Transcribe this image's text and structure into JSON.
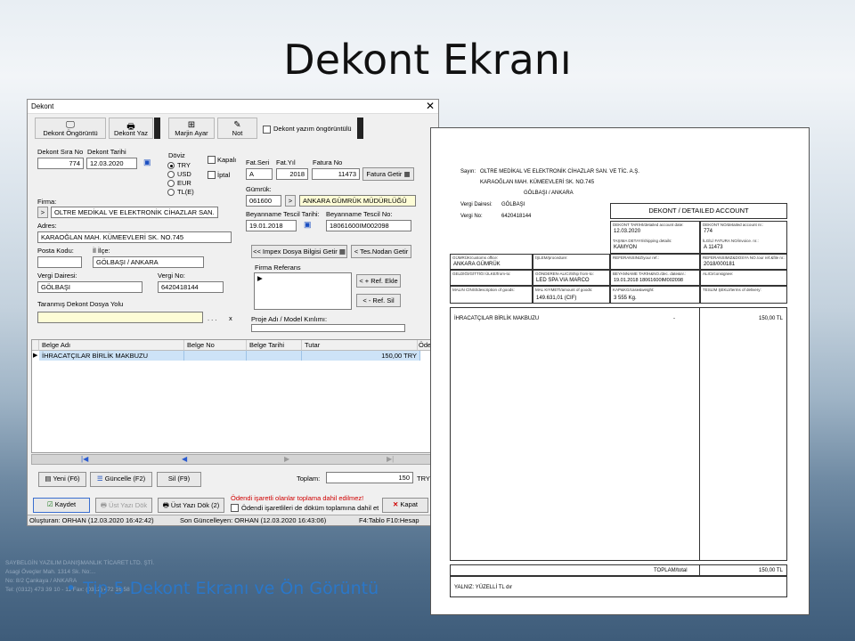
{
  "slide": {
    "title": "Dekont Ekranı",
    "bullet": "Tip 5 Dekont Ekranı ve Ön Görüntü",
    "bg_caption": [
      "SAYBELGİN YAZILIM DANIŞMANLIK TİCARET LTD. ŞTİ.",
      "Asagi Öveçler Mah. 1314 Sk. No:...",
      "No: 8/2 Çankaya / ANKARA",
      "Tel: (0312) 473 39 10 - 11 Fax: (0312) 472 16 58"
    ]
  },
  "dialog": {
    "title": "Dekont",
    "toolbar": {
      "preview": "Dekont Öngörüntü",
      "print": "Dekont Yaz",
      "margin": "Marjin Ayar",
      "note": "Not",
      "print_preview_check": "Dekont yazım öngörüntülü"
    },
    "fields": {
      "sira_no_label": "Dekont Sıra No",
      "sira_no": "774",
      "tarih_label": "Dekont Tarihi",
      "tarih": "12.03.2020",
      "doviz_label": "Döviz",
      "doviz_options": [
        "TRY",
        "USD",
        "EUR",
        "TL(E)"
      ],
      "doviz_selected": "TRY",
      "kapali": "Kapalı",
      "iptal": "İptal",
      "firma_label": "Firma:",
      "firma": "OLTRE MEDİKAL VE ELEKTRONİK CİHAZLAR SAN.",
      "adres_label": "Adres:",
      "adres": "KARAOĞLAN MAH. KÜMEEVLERİ SK. NO.745",
      "posta_label": "Posta Kodu:",
      "posta": "",
      "ilce_label": "İl İlçe:",
      "ilce": "GÖLBAŞI / ANKARA",
      "vd_label": "Vergi Dairesi:",
      "vd": "GÖLBAŞI",
      "vno_label": "Vergi No:",
      "vno": "6420418144",
      "taranmis_label": "Taranmış Dekont Dosya Yolu",
      "taranmis": "",
      "dots": ". . .",
      "x": "x",
      "fat_seri_label": "Fat.Seri",
      "fat_seri": "A",
      "fat_yil_label": "Fat.Yıl",
      "fat_yil": "2018",
      "fatura_no_label": "Fatura No",
      "fatura_no": "11473",
      "fatura_getir": "Fatura Getir",
      "gumruk_label": "Gümrük:",
      "gumruk_kod": "061600",
      "gumruk_ad": "ANKARA GÜMRÜK MÜDÜRLÜĞÜ",
      "bey_tarih_label": "Beyanname Tescil Tarihi:",
      "bey_tarih": "19.01.2018",
      "bey_no_label": "Beyanname Tescil No:",
      "bey_no": "18061600IM002098",
      "impex_btn": "<< Impex Dosya Bilgisi Getir",
      "tes_btn": "< Tes.Nodan Getir",
      "firma_ref_label": "Firma Referans",
      "ref_ekle": "< + Ref. Ekle",
      "ref_sil": "< - Ref. Sil",
      "proje_label": "Proje Adı / Model Kırılımı:"
    },
    "grid": {
      "headers": [
        "Belge Adı",
        "Belge No",
        "Belge Tarihi",
        "Tutar",
        "Ödendi"
      ],
      "rows": [
        {
          "ad": "İHRACATÇILAR BİRLİK MAKBUZU",
          "no": "",
          "tarih": "",
          "tutar": "150,00 TRY"
        }
      ]
    },
    "nav": [
      "|◀",
      "◀",
      "▶",
      "▶|"
    ],
    "actions": {
      "yeni": "Yeni (F6)",
      "guncelle": "Güncelle (F2)",
      "sil": "Sil (F9)",
      "toplam_label": "Toplam:",
      "toplam": "150",
      "toplam_cur": "TRY"
    },
    "bottom": {
      "kaydet": "Kaydet",
      "ust_yazi_dok": "Üst Yazı Dök",
      "ust_yazi_dok2": "Üst Yazı Dök (2)",
      "warn": "Ödendi işaretli olanlar toplama dahil edilmez!",
      "check": "Ödendi işaretlileri de döküm toplamına dahil et",
      "kapat": "Kapat"
    },
    "status": {
      "olusturan": "Oluşturan: ORHAN (12.03.2020 16:42:42)",
      "guncelleyen": "Son Güncelleyen: ORHAN (12.03.2020 16:43:06)",
      "keys": "F4:Tablo F10:Hesap"
    }
  },
  "preview": {
    "sayin_label": "Sayın:",
    "firma": "OLTRE MEDİKAL VE ELEKTRONİK CİHAZLAR SAN. VE TİC. A.Ş.",
    "adres": "KARAOĞLAN MAH. KÜMEEVLERİ SK. NO.745",
    "ilce": "GÖLBAŞI / ANKARA",
    "vd_label": "Vergi Dairesi:",
    "vd": "GÖLBAŞI",
    "vno_label": "Vergi No:",
    "vno": "6420418144",
    "header": "DEKONT / DETAILED ACCOUNT",
    "c1_label": "DEKONT TARİHİ/detailed account date:",
    "c1": "12.03.2020",
    "c2_label": "DEKONT NO/detailed account nr.:",
    "c2": "774",
    "c3_label": "TAŞIMA DETAYI/shipping details:",
    "c3": "KAMYON",
    "c4_label": "İLGİLİ FATURA NO/invoice. nr.:",
    "c4": "A 11473",
    "r1a_label": "GÜMRÜK/customs office:",
    "r1a": "ANKARA GÜMRÜK",
    "r1b_label": "İŞLEM/procedure:",
    "r1b": "",
    "r1c_label": "REFERANSINIZ/your ref.:",
    "r1c": "",
    "r1d_label": "REFERANSIMIZ&DOSYA NO./our ref.&file nr.:",
    "r1d": "2018/000181",
    "r2a_label": "GELDİĞİ/GİTTİĞİ ÜLKE/from-to:",
    "r2a": "",
    "r2b_label": "GÖNDEREN-ALICI/Ship from-to:",
    "r2b": "LED SPA VIA MARCO",
    "r2c_label": "BEYANNAME TARİH&NO./dec. date&nr.:",
    "r2c": "19.01.2018   18061600IM002098",
    "r2d_label": "ALICI/consignee:",
    "r2d": "",
    "r3a_label": "MALIN CİNSİ/description of goods:",
    "r3a": "",
    "r3b_label": "MAL KIYMETİ/amount of goods:",
    "r3b": "149.631,01     (CIF)",
    "r3c_label": "KAP&KG/case&weight:",
    "r3c": "3                  555 Kg.",
    "r3d_label": "TESLİM ŞEKLİ/terms of delivery:",
    "r3d": "",
    "item": "İHRACATÇILAR BİRLİK MAKBUZU",
    "item_dash": "-",
    "item_amt": "150,00 TL",
    "total_label": "TOPLAM/total",
    "total": "150,00 TL",
    "yalniz": "YALNIZ:  YÜZELLİ  TL  dır"
  }
}
